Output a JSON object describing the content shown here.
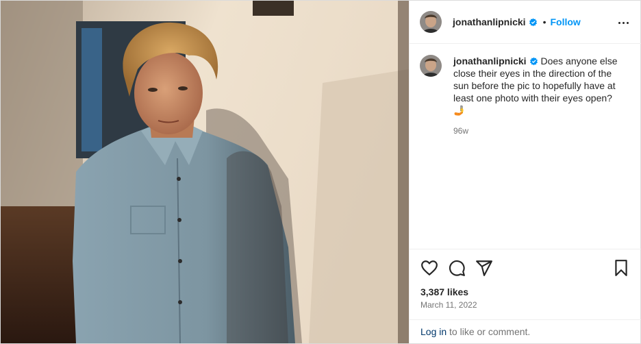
{
  "post": {
    "username": "jonathanlipnicki",
    "verified": true,
    "follow_label": "Follow",
    "separator": "•",
    "more_icon": "more-horizontal-icon",
    "caption": "Does anyone else close their eyes in the direction of the sun before the pic to hopefully have at least one photo with their eyes open? 🤳",
    "time_ago": "96w",
    "likes": "3,387 likes",
    "date": "March 11, 2022",
    "login_link": "Log in",
    "login_rest": " to like or comment.",
    "icons": [
      "heart-icon",
      "comment-icon",
      "share-icon",
      "bookmark-icon"
    ],
    "colors": {
      "accent": "#0095f6",
      "verified": "#0095f6",
      "muted": "#737373",
      "link": "#00376b"
    }
  }
}
